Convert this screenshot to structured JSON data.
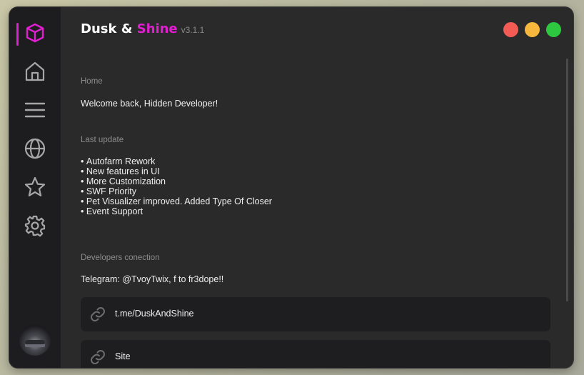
{
  "app": {
    "title_part1": "Dusk & ",
    "title_part2": "Shine",
    "version": "v3.1.1",
    "accent_color": "#e01fd0"
  },
  "window_controls": [
    {
      "name": "close",
      "color": "#f25c54"
    },
    {
      "name": "minimize",
      "color": "#f6b73c"
    },
    {
      "name": "maximize",
      "color": "#2ec840"
    }
  ],
  "sidebar": {
    "items": [
      {
        "icon": "cube-icon",
        "active": true
      },
      {
        "icon": "home-icon",
        "active": false
      },
      {
        "icon": "menu-icon",
        "active": false
      },
      {
        "icon": "globe-icon",
        "active": false
      },
      {
        "icon": "star-icon",
        "active": false
      },
      {
        "icon": "gear-icon",
        "active": false
      }
    ]
  },
  "home": {
    "section_label": "Home",
    "welcome_text": "Welcome back, Hidden Developer!"
  },
  "last_update": {
    "section_label": "Last update",
    "items": [
      "Autofarm Rework",
      "New features in UI",
      "More Customization",
      "SWF Priority",
      "Pet Visualizer improved. Added Type Of Closer",
      "Event Support"
    ]
  },
  "developers": {
    "section_label": "Developers conection",
    "telegram_text": "Telegram: @TvoyTwix, f to fr3dope!!",
    "links": [
      {
        "icon": "link-icon",
        "label": "t.me/DuskAndShine"
      },
      {
        "icon": "link-icon",
        "label": "Site"
      }
    ]
  }
}
